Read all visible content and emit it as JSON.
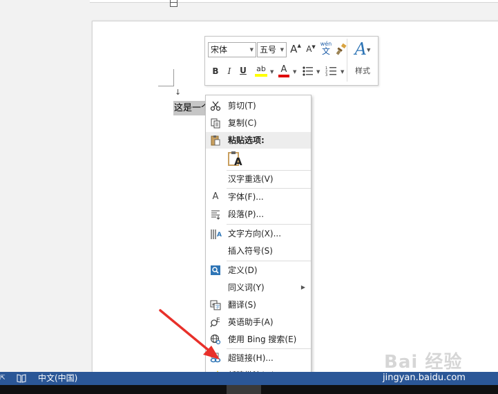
{
  "document": {
    "selected_text": "这是一个",
    "paragraph_mark": "↓"
  },
  "mini_toolbar": {
    "font_name": "宋体",
    "font_size": "五号",
    "grow_font_icon": "A",
    "shrink_font_icon": "A",
    "phonetic_guide_top": "wén",
    "phonetic_guide_bottom": "文",
    "bold": "B",
    "italic": "I",
    "underline": "U",
    "highlight_text": "ab",
    "font_color_text": "A",
    "styles_icon": "A",
    "styles_label": "样式",
    "highlight_color": "#ffff00",
    "font_color": "#e00000"
  },
  "context_menu": {
    "items": [
      {
        "label": "剪切(T)",
        "icon": "scissors-icon",
        "glyph": "✂"
      },
      {
        "label": "复制(C)",
        "icon": "copy-icon",
        "glyph": "⎘"
      },
      {
        "label": "粘贴选项:",
        "icon": "paste-icon",
        "glyph": "📋"
      },
      {
        "label": "A",
        "icon": "paste-keep-text-icon"
      },
      {
        "label": "汉字重选(V)",
        "icon": ""
      },
      {
        "label": "字体(F)...",
        "icon": "font-icon",
        "glyph": "A"
      },
      {
        "label": "段落(P)...",
        "icon": "paragraph-icon",
        "glyph": "≡"
      },
      {
        "label": "文字方向(X)...",
        "icon": "text-direction-icon",
        "glyph": "‖A"
      },
      {
        "label": "插入符号(S)",
        "icon": ""
      },
      {
        "label": "定义(D)",
        "icon": "define-icon",
        "glyph": "🔍"
      },
      {
        "label": "同义词(Y)",
        "icon": ""
      },
      {
        "label": "翻译(S)",
        "icon": "translate-icon",
        "glyph": "⇄"
      },
      {
        "label": "英语助手(A)",
        "icon": "english-assistant-icon",
        "glyph": "ε"
      },
      {
        "label": "使用 Bing 搜索(E)",
        "icon": "bing-search-icon",
        "glyph": "⊕"
      },
      {
        "label": "超链接(H)...",
        "icon": "hyperlink-icon",
        "glyph": "⛓"
      },
      {
        "label": "新建批注(M)",
        "icon": "new-comment-icon",
        "glyph": "✎"
      }
    ]
  },
  "statusbar": {
    "language": "中文(中国)"
  },
  "watermark": {
    "logo": "Bai 经验",
    "url": "jingyan.baidu.com"
  },
  "colors": {
    "statusbar_bg": "#2b5797",
    "arrow": "#e8302a"
  }
}
